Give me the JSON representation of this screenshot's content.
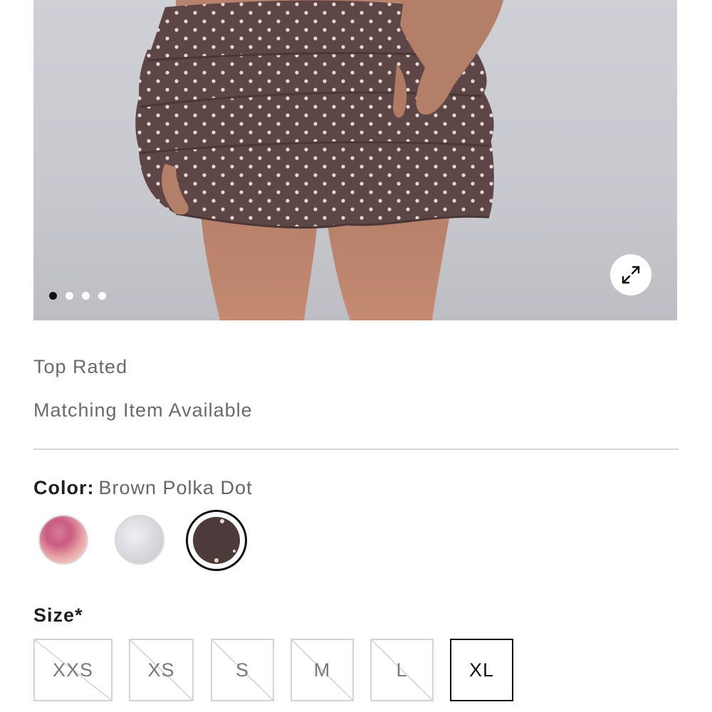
{
  "gallery": {
    "image_icon": "product-photo-polka-dot-ruffle-skirt",
    "slide_count": 4,
    "active_slide": 1,
    "expand_icon": "expand-arrows-icon"
  },
  "badges": {
    "top_rated": "Top Rated",
    "matching": "Matching Item Available"
  },
  "color": {
    "label": "Color:",
    "selected": "Brown Polka Dot",
    "swatches": [
      {
        "name": "pink",
        "selected": false
      },
      {
        "name": "white",
        "selected": false
      },
      {
        "name": "brown-polka-dot",
        "selected": true
      }
    ]
  },
  "size": {
    "label": "Size*",
    "options": [
      {
        "label": "XXS",
        "available": false
      },
      {
        "label": "XS",
        "available": false
      },
      {
        "label": "S",
        "available": false
      },
      {
        "label": "M",
        "available": false
      },
      {
        "label": "L",
        "available": false
      },
      {
        "label": "XL",
        "available": true,
        "selected": true
      }
    ]
  },
  "colors": {
    "skirt": "#5e4646",
    "dot_active": "#111111",
    "border": "#d3d3d3"
  }
}
